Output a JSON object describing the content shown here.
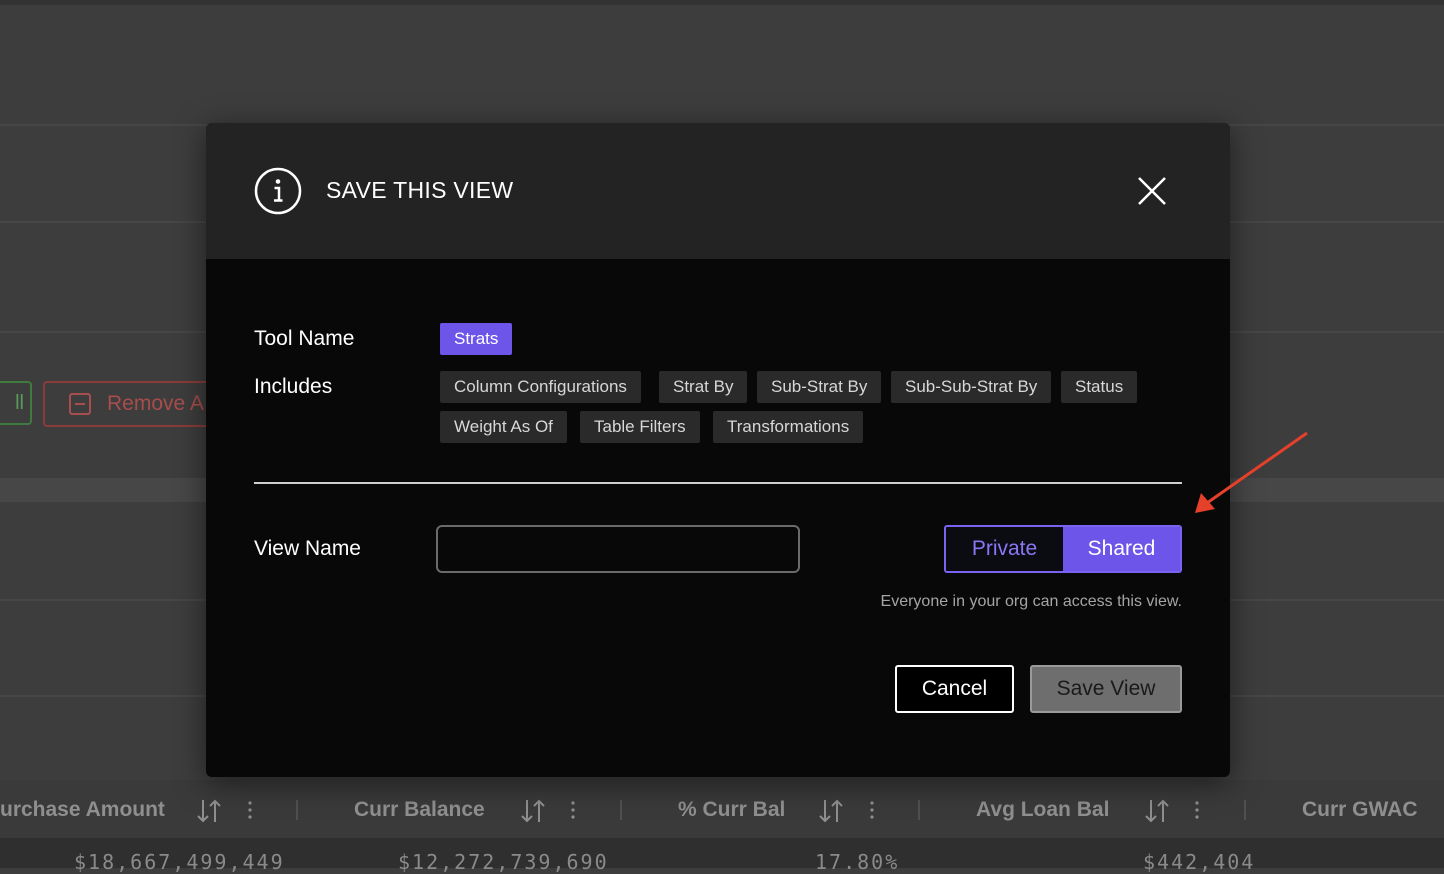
{
  "background": {
    "partial_button_text": "ll",
    "remove_button_label": "Remove A",
    "columns": [
      {
        "header": "urchase Amount",
        "value": "$18,667,499,449"
      },
      {
        "header": "Curr Balance",
        "value": "$12,272,739,690"
      },
      {
        "header": "% Curr Bal",
        "value": "17.80%"
      },
      {
        "header": "Avg Loan Bal",
        "value": "$442,404"
      },
      {
        "header": "Curr GWAC",
        "value": ""
      }
    ]
  },
  "modal": {
    "title": "SAVE THIS VIEW",
    "tool_name_label": "Tool Name",
    "tool_name_tag": "Strats",
    "includes_label": "Includes",
    "includes_tags": [
      "Column Configurations",
      "Strat By",
      "Sub-Strat By",
      "Sub-Sub-Strat By",
      "Status",
      "Weight As Of",
      "Table Filters",
      "Transformations"
    ],
    "view_name_label": "View Name",
    "view_name_value": "",
    "view_name_placeholder": "",
    "visibility_toggle": {
      "options": [
        "Private",
        "Shared"
      ],
      "selected": "Shared"
    },
    "helper_text": "Everyone in your org can access this view.",
    "cancel_label": "Cancel",
    "save_label": "Save View"
  },
  "colors": {
    "accent": "#6c55e8",
    "modal_background": "#080808",
    "header_background": "#232323",
    "annotation_arrow": "#e5402a"
  }
}
